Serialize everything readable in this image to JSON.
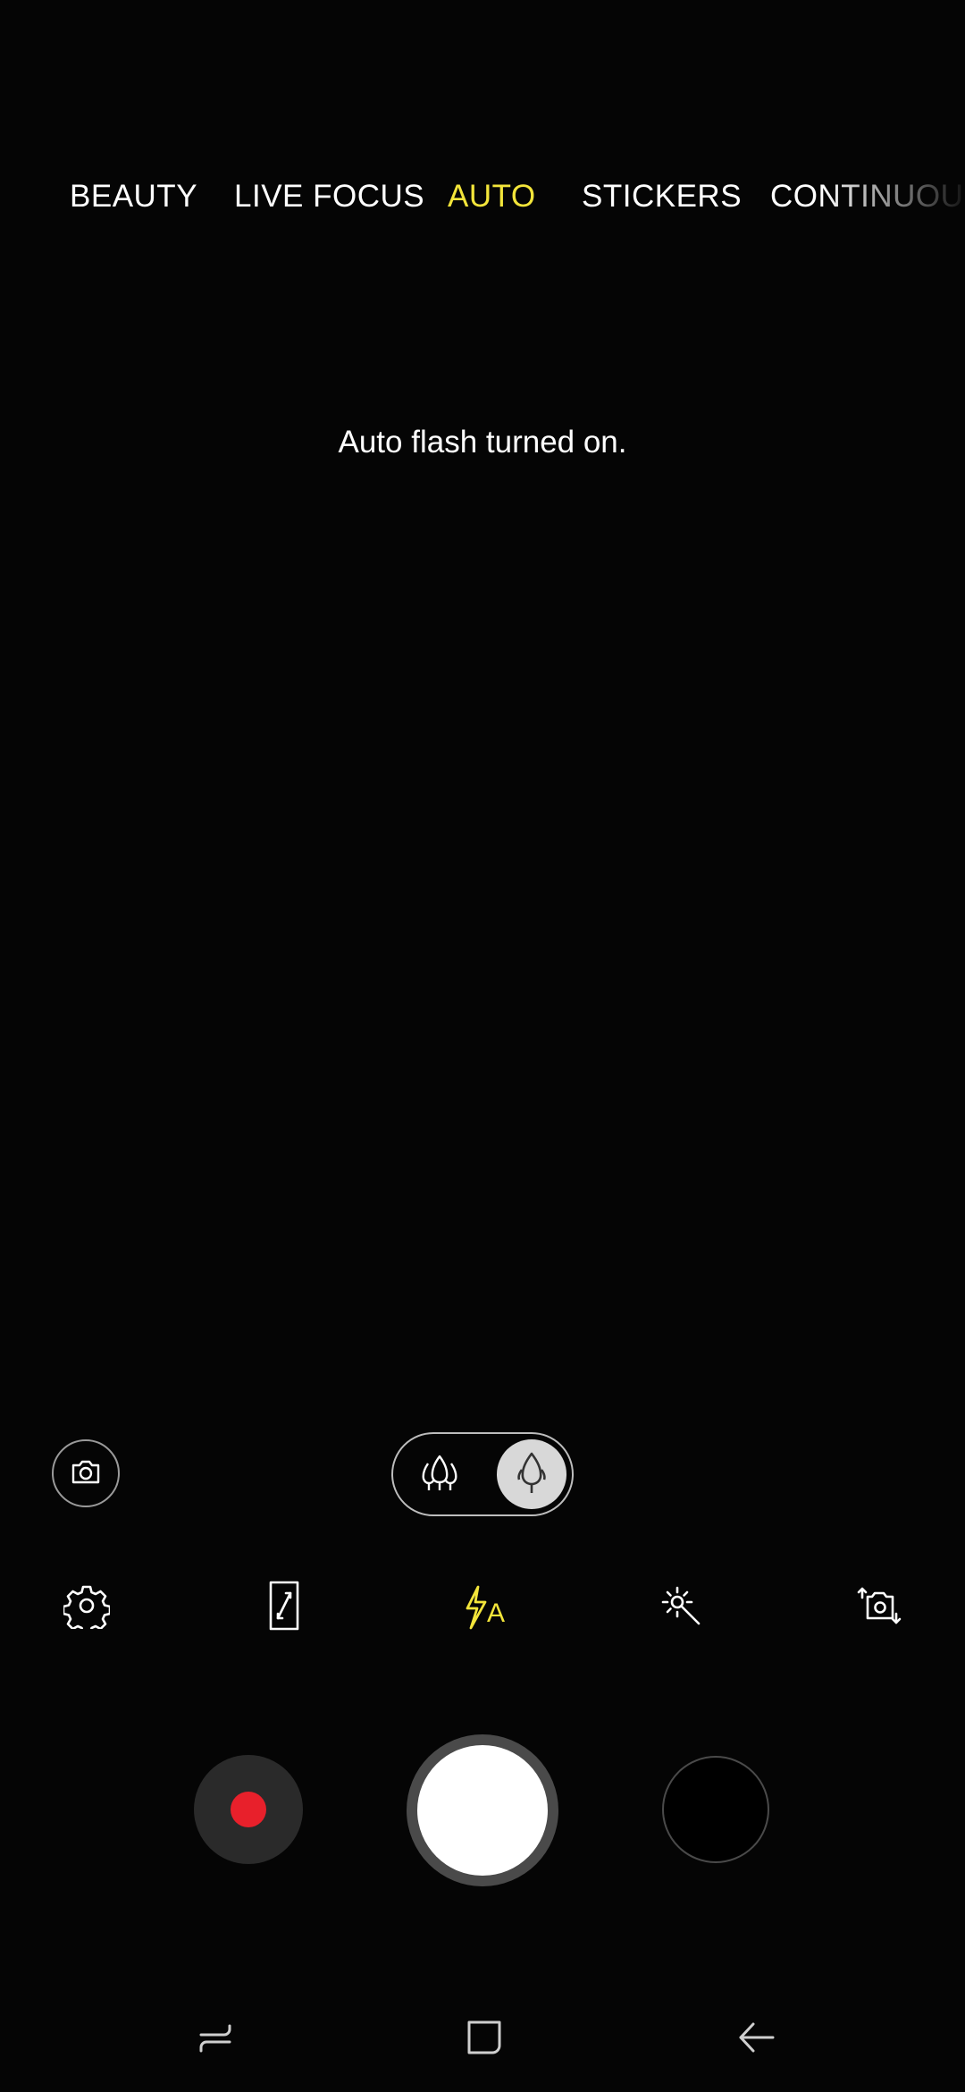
{
  "modes": {
    "items": [
      "BEAUTY",
      "LIVE FOCUS",
      "AUTO",
      "STICKERS",
      "CONTINUOUS S"
    ],
    "active": "AUTO",
    "colors": {
      "active": "#f3e53a",
      "inactive": "#ffffff"
    }
  },
  "toast": {
    "message": "Auto flash turned on."
  },
  "lens": {
    "switch_icon": "camera-switch-icon",
    "wide_icon": "wide-angle-trees-icon",
    "normal_icon": "normal-angle-tree-icon",
    "selected": "normal"
  },
  "settings_row": {
    "settings_icon": "gear-icon",
    "aspect_icon": "aspect-ratio-icon",
    "flash_icon": "flash-auto-icon",
    "flash_label": "A",
    "filter_icon": "magic-wand-icon",
    "flip_icon": "camera-flip-icon",
    "flash_color": "#f3e53a"
  },
  "shutter_row": {
    "record_color": "#e8202b",
    "shutter_color": "#ffffff"
  },
  "nav_bar": {
    "recents_icon": "recents-icon",
    "home_icon": "home-icon",
    "back_icon": "back-arrow-icon"
  }
}
